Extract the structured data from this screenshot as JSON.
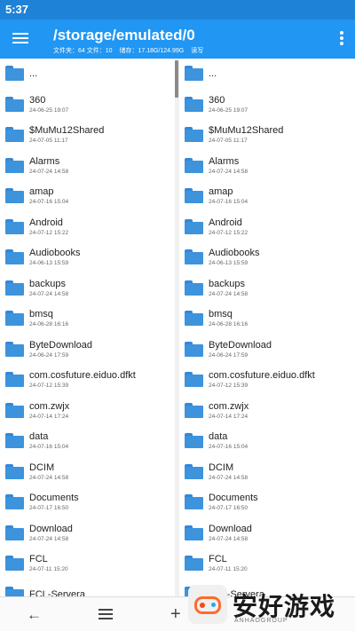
{
  "status_bar": {
    "time": "5:37"
  },
  "toolbar": {
    "title": "/storage/emulated/0",
    "folders_label": "文件夹：64 文件：10",
    "storage_label": "储存：17.18G/124.99G",
    "mode_label": "读写"
  },
  "left_pane": {
    "items": [
      {
        "name": "...",
        "date": ""
      },
      {
        "name": "360",
        "date": "24-06-25 19:07"
      },
      {
        "name": "$MuMu12Shared",
        "date": "24-07-05 11:17"
      },
      {
        "name": "Alarms",
        "date": "24-07-24 14:58"
      },
      {
        "name": "amap",
        "date": "24-07-16 15:04"
      },
      {
        "name": "Android",
        "date": "24-07-12 15:22"
      },
      {
        "name": "Audiobooks",
        "date": "24-06-13 15:59"
      },
      {
        "name": "backups",
        "date": "24-07-24 14:58"
      },
      {
        "name": "bmsq",
        "date": "24-06-28 16:16"
      },
      {
        "name": "ByteDownload",
        "date": "24-06-24 17:59"
      },
      {
        "name": "com.cosfuture.eiduo.dfkt",
        "date": "24-07-12 15:39"
      },
      {
        "name": "com.zwjx",
        "date": "24-07-14 17:24"
      },
      {
        "name": "data",
        "date": "24-07-16 15:04"
      },
      {
        "name": "DCIM",
        "date": "24-07-24 14:58"
      },
      {
        "name": "Documents",
        "date": "24-07-17 16:50"
      },
      {
        "name": "Download",
        "date": "24-07-24 14:58"
      },
      {
        "name": "FCL",
        "date": "24-07-11 15:20"
      },
      {
        "name": "FCL-Servera",
        "date": ""
      }
    ]
  },
  "right_pane": {
    "items": [
      {
        "name": "...",
        "date": ""
      },
      {
        "name": "360",
        "date": "24-06-25 19:07"
      },
      {
        "name": "$MuMu12Shared",
        "date": "24-07-05 11:17"
      },
      {
        "name": "Alarms",
        "date": "24-07-24 14:58"
      },
      {
        "name": "amap",
        "date": "24-07-16 15:04"
      },
      {
        "name": "Android",
        "date": "24-07-12 15:22"
      },
      {
        "name": "Audiobooks",
        "date": "24-06-13 15:59"
      },
      {
        "name": "backups",
        "date": "24-07-24 14:58"
      },
      {
        "name": "bmsq",
        "date": "24-06-28 16:16"
      },
      {
        "name": "ByteDownload",
        "date": "24-06-24 17:59"
      },
      {
        "name": "com.cosfuture.eiduo.dfkt",
        "date": "24-07-12 15:39"
      },
      {
        "name": "com.zwjx",
        "date": "24-07-14 17:24"
      },
      {
        "name": "data",
        "date": "24-07-16 15:04"
      },
      {
        "name": "DCIM",
        "date": "24-07-24 14:58"
      },
      {
        "name": "Documents",
        "date": "24-07-17 16:50"
      },
      {
        "name": "Download",
        "date": "24-07-24 14:58"
      },
      {
        "name": "FCL",
        "date": "24-07-11 15:20"
      },
      {
        "name": "FCL-Servera",
        "date": ""
      }
    ]
  },
  "nav_bar": {
    "back_icon": "←",
    "add_icon": "+"
  },
  "watermark": {
    "text": "安好游戏",
    "url": "ANHAOGROUP"
  },
  "colors": {
    "toolbar": "#2196f3",
    "status_bar": "#1e82d6",
    "folder": "#3d93dc"
  },
  "icons": [
    "menu-icon",
    "more-vert-icon",
    "folder-icon",
    "back-arrow-icon",
    "home-menu-icon",
    "add-icon"
  ]
}
